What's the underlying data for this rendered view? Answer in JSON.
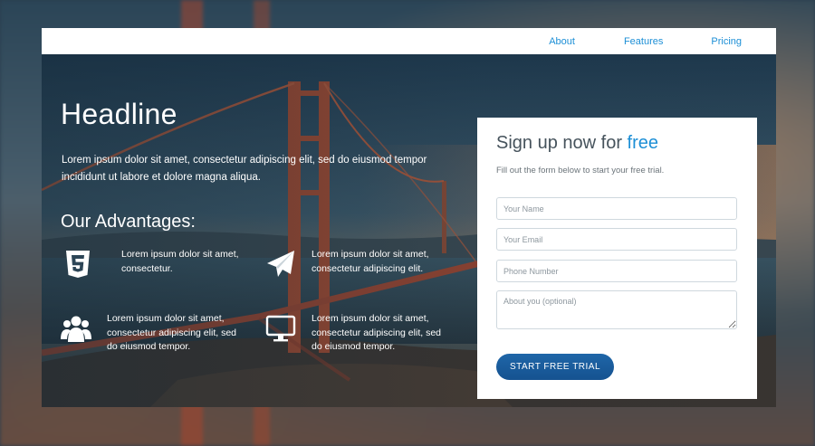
{
  "nav": {
    "items": [
      {
        "label": "About"
      },
      {
        "label": "Features"
      },
      {
        "label": "Pricing"
      }
    ]
  },
  "hero": {
    "headline": "Headline",
    "lead": "Lorem ipsum dolor sit amet, consectetur adipiscing elit, sed do eiusmod tempor incididunt ut labore et dolore magna aliqua.",
    "advantages_title": "Our Advantages:",
    "features": [
      {
        "icon": "html5-icon",
        "text": "Lorem ipsum dolor sit amet, consectetur."
      },
      {
        "icon": "paper-plane-icon",
        "text": "Lorem ipsum dolor sit amet, consectetur adipiscing elit."
      },
      {
        "icon": "users-icon",
        "text": "Lorem ipsum dolor sit amet, consectetur adipiscing elit, sed do eiusmod tempor."
      },
      {
        "icon": "monitor-icon",
        "text": "Lorem ipsum dolor sit amet, consectetur adipiscing elit, sed do eiusmod tempor."
      }
    ]
  },
  "signup": {
    "title_prefix": "Sign up now for ",
    "title_accent": "free",
    "subtitle": "Fill out the form below to start your free trial.",
    "fields": {
      "name_placeholder": "Your Name",
      "email_placeholder": "Your Email",
      "phone_placeholder": "Phone Number",
      "about_placeholder": "About you (optional)"
    },
    "cta_label": "START FREE TRIAL"
  },
  "colors": {
    "accent": "#1d8fd6",
    "cta": "#1a5e9e",
    "card": "#ffffff"
  }
}
